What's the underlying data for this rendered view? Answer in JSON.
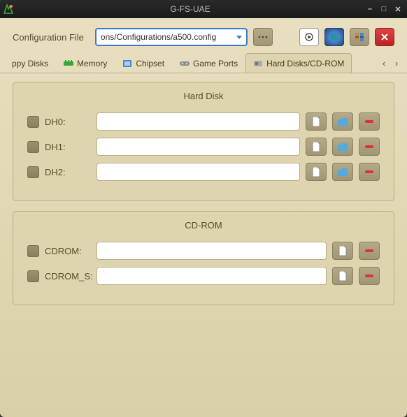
{
  "window": {
    "title": "G-FS-UAE"
  },
  "config": {
    "label": "Configuration File",
    "value": "ons/Configurations/a500.config"
  },
  "tabs": {
    "items": [
      {
        "label": "ppy Disks"
      },
      {
        "label": "Memory"
      },
      {
        "label": "Chipset"
      },
      {
        "label": "Game Ports"
      },
      {
        "label": "Hard Disks/CD-ROM"
      }
    ]
  },
  "panels": {
    "hd": {
      "title": "Hard Disk",
      "drives": [
        {
          "label": "DH0:",
          "value": ""
        },
        {
          "label": "DH1:",
          "value": ""
        },
        {
          "label": "DH2:",
          "value": ""
        }
      ]
    },
    "cd": {
      "title": "CD-ROM",
      "drives": [
        {
          "label": "CDROM:",
          "value": ""
        },
        {
          "label": "CDROM_S:",
          "value": ""
        }
      ]
    }
  }
}
